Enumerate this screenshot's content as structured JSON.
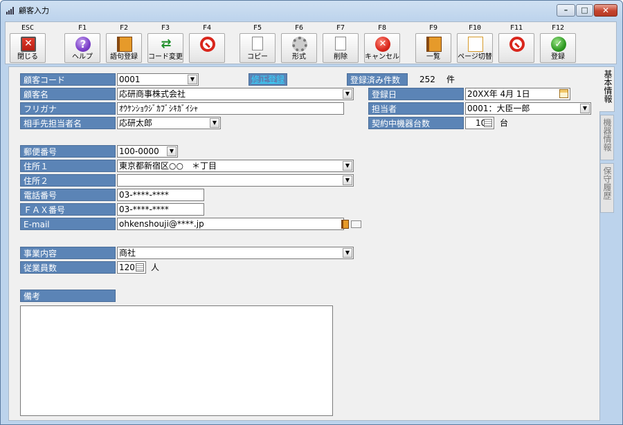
{
  "window": {
    "title": "顧客入力"
  },
  "toolbar": [
    {
      "key": "ESC",
      "label": "閉じる",
      "icon": "exit-icon"
    },
    {
      "key": "F1",
      "label": "ヘルプ",
      "icon": "help-icon"
    },
    {
      "key": "F2",
      "label": "語句登録",
      "icon": "book-icon"
    },
    {
      "key": "F3",
      "label": "コード変更",
      "icon": "shuffle-icon"
    },
    {
      "key": "F4",
      "label": "",
      "icon": "prohibited-icon"
    },
    {
      "key": "F5",
      "label": "コピー",
      "icon": "copy-icon"
    },
    {
      "key": "F6",
      "label": "形式",
      "icon": "gear-icon"
    },
    {
      "key": "F7",
      "label": "削除",
      "icon": "delete-doc-icon"
    },
    {
      "key": "F8",
      "label": "キャンセル",
      "icon": "cancel-icon"
    },
    {
      "key": "F9",
      "label": "一覧",
      "icon": "list-book-icon"
    },
    {
      "key": "F10",
      "label": "ページ切替",
      "icon": "page-switch-icon"
    },
    {
      "key": "F11",
      "label": "",
      "icon": "prohibited-icon"
    },
    {
      "key": "F12",
      "label": "登録",
      "icon": "check-icon"
    }
  ],
  "form": {
    "customer_code_label": "顧客コード",
    "customer_code": "0001",
    "edit_mode_badge": "修正登録",
    "registered_count_label": "登録済み件数",
    "registered_count": "252",
    "registered_count_unit": "件",
    "customer_name_label": "顧客名",
    "customer_name": "応研商事株式会社",
    "furigana_label": "フリガナ",
    "furigana": "ｵｳｹﾝｼｮｳｼﾞｶﾌﾞｼｷｶﾞｲｼｬ",
    "contact_label": "相手先担当者名",
    "contact": "応研太郎",
    "reg_date_label": "登録日",
    "reg_date": "20XX年 4月 1日",
    "staff_label": "担当者",
    "staff": "0001：大臣一郎",
    "machines_label": "契約中機器台数",
    "machines": "10",
    "machines_unit": "台",
    "postal_label": "郵便番号",
    "postal": "100-0000",
    "address1_label": "住所１",
    "address1": "東京都新宿区○○　＊丁目",
    "address2_label": "住所２",
    "address2": "",
    "phone_label": "電話番号",
    "phone": "03-****-****",
    "fax_label": "ＦＡＸ番号",
    "fax": "03-****-****",
    "email_label": "E-mail",
    "email": "ohkenshouji@****.jp",
    "business_label": "事業内容",
    "business": "商社",
    "employees_label": "従業員数",
    "employees": "120",
    "employees_unit": "人",
    "memo_label": "備考",
    "memo": ""
  },
  "tabs": [
    {
      "label": "基本情報",
      "active": true
    },
    {
      "label": "機器情報",
      "active": false
    },
    {
      "label": "保守履歴",
      "active": false
    }
  ]
}
